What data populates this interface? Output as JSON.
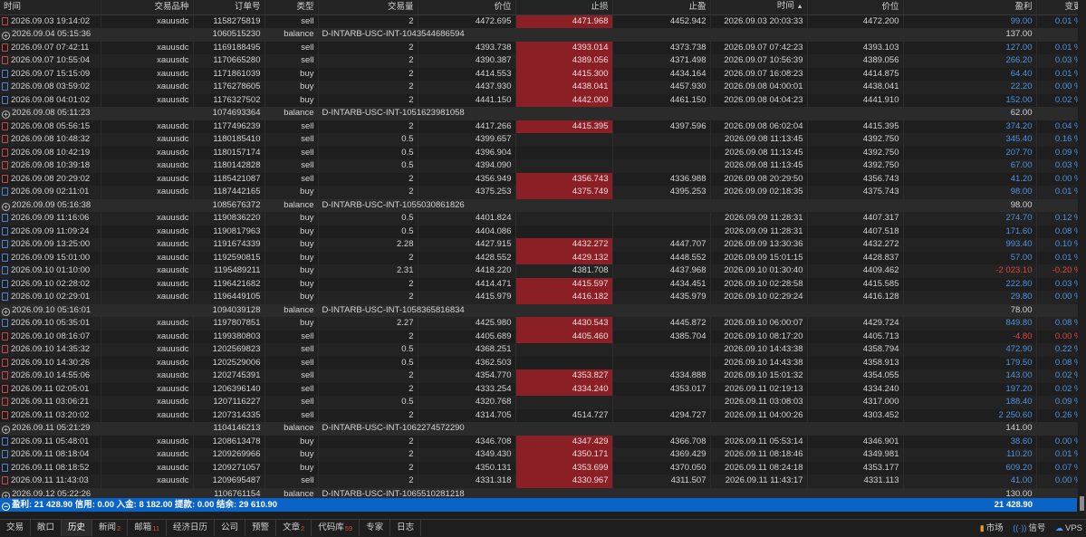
{
  "headers": [
    "时间",
    "交易品种",
    "订单号",
    "类型",
    "交易量",
    "价位",
    "止损",
    "止盈",
    "时间",
    "价位",
    "盈利",
    "变更"
  ],
  "sort_indicator": "▲",
  "rows": [
    {
      "kind": "trade",
      "t1": "2026.09.03 19:14:02",
      "sym": "xauusdc",
      "order": "1158275819",
      "type": "sell",
      "vol": "2",
      "p1": "4472.695",
      "sl": "4471.968",
      "sl_hit": true,
      "tp": "4452.942",
      "t2": "2026.09.03 20:03:33",
      "p2": "4472.200",
      "profit": "99.00",
      "chg": "0.01 %",
      "neg": false
    },
    {
      "kind": "balance",
      "t1": "2026.09.04 05:15:36",
      "order": "1060515230",
      "type": "balance",
      "comment": "D-INTARB-USC-INT-1043544686594",
      "profit": "137.00"
    },
    {
      "kind": "trade",
      "t1": "2026.09.07 07:42:11",
      "sym": "xauusdc",
      "order": "1169188495",
      "type": "sell",
      "vol": "2",
      "p1": "4393.738",
      "sl": "4393.014",
      "sl_hit": true,
      "tp": "4373.738",
      "t2": "2026.09.07 07:42:23",
      "p2": "4393.103",
      "profit": "127.00",
      "chg": "0.01 %",
      "neg": false
    },
    {
      "kind": "trade",
      "t1": "2026.09.07 10:55:04",
      "sym": "xauusdc",
      "order": "1170665280",
      "type": "sell",
      "vol": "2",
      "p1": "4390.387",
      "sl": "4389.056",
      "sl_hit": true,
      "tp": "4371.498",
      "t2": "2026.09.07 10:56:39",
      "p2": "4389.056",
      "profit": "266.20",
      "chg": "0.03 %",
      "neg": false
    },
    {
      "kind": "trade",
      "t1": "2026.09.07 15:15:09",
      "sym": "xauusdc",
      "order": "1171861039",
      "type": "buy",
      "vol": "2",
      "p1": "4414.553",
      "sl": "4415.300",
      "sl_hit": true,
      "tp": "4434.164",
      "t2": "2026.09.07 16:08:23",
      "p2": "4414.875",
      "profit": "64.40",
      "chg": "0.01 %",
      "neg": false
    },
    {
      "kind": "trade",
      "t1": "2026.09.08 03:59:02",
      "sym": "xauusdc",
      "order": "1176278605",
      "type": "buy",
      "vol": "2",
      "p1": "4437.930",
      "sl": "4438.041",
      "sl_hit": true,
      "tp": "4457.930",
      "t2": "2026.09.08 04:00:01",
      "p2": "4438.041",
      "profit": "22.20",
      "chg": "0.00 %",
      "neg": false
    },
    {
      "kind": "trade",
      "t1": "2026.09.08 04:01:02",
      "sym": "xauusdc",
      "order": "1176327502",
      "type": "buy",
      "vol": "2",
      "p1": "4441.150",
      "sl": "4442.000",
      "sl_hit": true,
      "tp": "4461.150",
      "t2": "2026.09.08 04:04:23",
      "p2": "4441.910",
      "profit": "152.00",
      "chg": "0.02 %",
      "neg": false
    },
    {
      "kind": "balance",
      "t1": "2026.09.08 05:11:23",
      "order": "1074693364",
      "type": "balance",
      "comment": "D-INTARB-USC-INT-1051623981058",
      "profit": "62.00"
    },
    {
      "kind": "trade",
      "t1": "2026.09.08 05:56:15",
      "sym": "xauusdc",
      "order": "1177496239",
      "type": "sell",
      "vol": "2",
      "p1": "4417.266",
      "sl": "4415.395",
      "sl_hit": true,
      "tp": "4397.596",
      "t2": "2026.09.08 06:02:04",
      "p2": "4415.395",
      "profit": "374.20",
      "chg": "0.04 %",
      "neg": false
    },
    {
      "kind": "trade",
      "t1": "2026.09.08 10:48:32",
      "sym": "xauusdc",
      "order": "1180185410",
      "type": "sell",
      "vol": "0.5",
      "p1": "4399.657",
      "sl": "",
      "sl_hit": false,
      "tp": "",
      "t2": "2026.09.08 11:13:45",
      "p2": "4392.750",
      "profit": "345.40",
      "chg": "0.16 %",
      "neg": false
    },
    {
      "kind": "trade",
      "t1": "2026.09.08 10:42:19",
      "sym": "xauusdc",
      "order": "1180157174",
      "type": "sell",
      "vol": "0.5",
      "p1": "4396.904",
      "sl": "",
      "sl_hit": false,
      "tp": "",
      "t2": "2026.09.08 11:13:45",
      "p2": "4392.750",
      "profit": "207.70",
      "chg": "0.09 %",
      "neg": false
    },
    {
      "kind": "trade",
      "t1": "2026.09.08 10:39:18",
      "sym": "xauusdc",
      "order": "1180142828",
      "type": "sell",
      "vol": "0.5",
      "p1": "4394.090",
      "sl": "",
      "sl_hit": false,
      "tp": "",
      "t2": "2026.09.08 11:13:45",
      "p2": "4392.750",
      "profit": "67.00",
      "chg": "0.03 %",
      "neg": false
    },
    {
      "kind": "trade",
      "t1": "2026.09.08 20:29:02",
      "sym": "xauusdc",
      "order": "1185421087",
      "type": "sell",
      "vol": "2",
      "p1": "4356.949",
      "sl": "4356.743",
      "sl_hit": true,
      "tp": "4336.988",
      "t2": "2026.09.08 20:29:50",
      "p2": "4356.743",
      "profit": "41.20",
      "chg": "0.00 %",
      "neg": false
    },
    {
      "kind": "trade",
      "t1": "2026.09.09 02:11:01",
      "sym": "xauusdc",
      "order": "1187442165",
      "type": "buy",
      "vol": "2",
      "p1": "4375.253",
      "sl": "4375.749",
      "sl_hit": true,
      "tp": "4395.253",
      "t2": "2026.09.09 02:18:35",
      "p2": "4375.743",
      "profit": "98.00",
      "chg": "0.01 %",
      "neg": false
    },
    {
      "kind": "balance",
      "t1": "2026.09.09 05:16:38",
      "order": "1085676372",
      "type": "balance",
      "comment": "D-INTARB-USC-INT-1055030861826",
      "profit": "98.00"
    },
    {
      "kind": "trade",
      "t1": "2026.09.09 11:16:06",
      "sym": "xauusdc",
      "order": "1190836220",
      "type": "buy",
      "vol": "0.5",
      "p1": "4401.824",
      "sl": "",
      "sl_hit": false,
      "tp": "",
      "t2": "2026.09.09 11:28:31",
      "p2": "4407.317",
      "profit": "274.70",
      "chg": "0.12 %",
      "neg": false
    },
    {
      "kind": "trade",
      "t1": "2026.09.09 11:09:24",
      "sym": "xauusdc",
      "order": "1190817963",
      "type": "buy",
      "vol": "0.5",
      "p1": "4404.086",
      "sl": "",
      "sl_hit": false,
      "tp": "",
      "t2": "2026.09.09 11:28:31",
      "p2": "4407.518",
      "profit": "171.60",
      "chg": "0.08 %",
      "neg": false
    },
    {
      "kind": "trade",
      "t1": "2026.09.09 13:25:00",
      "sym": "xauusdc",
      "order": "1191674339",
      "type": "buy",
      "vol": "2.28",
      "p1": "4427.915",
      "sl": "4432.272",
      "sl_hit": true,
      "tp": "4447.707",
      "t2": "2026.09.09 13:30:36",
      "p2": "4432.272",
      "profit": "993.40",
      "chg": "0.10 %",
      "neg": false
    },
    {
      "kind": "trade",
      "t1": "2026.09.09 15:01:00",
      "sym": "xauusdc",
      "order": "1192590815",
      "type": "buy",
      "vol": "2",
      "p1": "4428.552",
      "sl": "4429.132",
      "sl_hit": true,
      "tp": "4448.552",
      "t2": "2026.09.09 15:01:15",
      "p2": "4428.837",
      "profit": "57.00",
      "chg": "0.01 %",
      "neg": false
    },
    {
      "kind": "trade",
      "t1": "2026.09.10 01:10:00",
      "sym": "xauusdc",
      "order": "1195489211",
      "type": "buy",
      "vol": "2.31",
      "p1": "4418.220",
      "sl": "4381.708",
      "sl_hit": false,
      "tp": "4437.968",
      "t2": "2026.09.10 01:30:40",
      "p2": "4409.462",
      "profit": "-2 023.10",
      "chg": "-0.20 %",
      "neg": true
    },
    {
      "kind": "trade",
      "t1": "2026.09.10 02:28:02",
      "sym": "xauusdc",
      "order": "1196421682",
      "type": "buy",
      "vol": "2",
      "p1": "4414.471",
      "sl": "4415.597",
      "sl_hit": true,
      "tp": "4434.451",
      "t2": "2026.09.10 02:28:58",
      "p2": "4415.585",
      "profit": "222.80",
      "chg": "0.03 %",
      "neg": false
    },
    {
      "kind": "trade",
      "t1": "2026.09.10 02:29:01",
      "sym": "xauusdc",
      "order": "1196449105",
      "type": "buy",
      "vol": "2",
      "p1": "4415.979",
      "sl": "4416.182",
      "sl_hit": true,
      "tp": "4435.979",
      "t2": "2026.09.10 02:29:24",
      "p2": "4416.128",
      "profit": "29.80",
      "chg": "0.00 %",
      "neg": false
    },
    {
      "kind": "balance",
      "t1": "2026.09.10 05:16:01",
      "order": "1094039128",
      "type": "balance",
      "comment": "D-INTARB-USC-INT-1058365816834",
      "profit": "78.00"
    },
    {
      "kind": "trade",
      "t1": "2026.09.10 05:35:01",
      "sym": "xauusdc",
      "order": "1197807851",
      "type": "buy",
      "vol": "2.27",
      "p1": "4425.980",
      "sl": "4430.543",
      "sl_hit": true,
      "tp": "4445.872",
      "t2": "2026.09.10 06:00:07",
      "p2": "4429.724",
      "profit": "849.80",
      "chg": "0.08 %",
      "neg": false
    },
    {
      "kind": "trade",
      "t1": "2026.09.10 08:16:07",
      "sym": "xauusdc",
      "order": "1199380803",
      "type": "sell",
      "vol": "2",
      "p1": "4405.689",
      "sl": "4405.460",
      "sl_hit": true,
      "tp": "4385.704",
      "t2": "2026.09.10 08:17:20",
      "p2": "4405.713",
      "profit": "-4.80",
      "chg": "0.00 %",
      "neg": true
    },
    {
      "kind": "trade",
      "t1": "2026.09.10 14:35:32",
      "sym": "xauusdc",
      "order": "1202569823",
      "type": "sell",
      "vol": "0.5",
      "p1": "4368.251",
      "sl": "",
      "sl_hit": false,
      "tp": "",
      "t2": "2026.09.10 14:43:38",
      "p2": "4358.794",
      "profit": "472.90",
      "chg": "0.22 %",
      "neg": false
    },
    {
      "kind": "trade",
      "t1": "2026.09.10 14:30:26",
      "sym": "xauusdc",
      "order": "1202529006",
      "type": "sell",
      "vol": "0.5",
      "p1": "4362.503",
      "sl": "",
      "sl_hit": false,
      "tp": "",
      "t2": "2026.09.10 14:43:38",
      "p2": "4358.913",
      "profit": "179.50",
      "chg": "0.08 %",
      "neg": false
    },
    {
      "kind": "trade",
      "t1": "2026.09.10 14:55:06",
      "sym": "xauusdc",
      "order": "1202745391",
      "type": "sell",
      "vol": "2",
      "p1": "4354.770",
      "sl": "4353.827",
      "sl_hit": true,
      "tp": "4334.888",
      "t2": "2026.09.10 15:01:32",
      "p2": "4354.055",
      "profit": "143.00",
      "chg": "0.02 %",
      "neg": false
    },
    {
      "kind": "trade",
      "t1": "2026.09.11 02:05:01",
      "sym": "xauusdc",
      "order": "1206396140",
      "type": "sell",
      "vol": "2",
      "p1": "4333.254",
      "sl": "4334.240",
      "sl_hit": true,
      "tp": "4353.017",
      "t2": "2026.09.11 02:19:13",
      "p2": "4334.240",
      "profit": "197.20",
      "chg": "0.02 %",
      "neg": false
    },
    {
      "kind": "trade",
      "t1": "2026.09.11 03:06:21",
      "sym": "xauusdc",
      "order": "1207116227",
      "type": "sell",
      "vol": "0.5",
      "p1": "4320.768",
      "sl": "",
      "sl_hit": false,
      "tp": "",
      "t2": "2026.09.11 03:08:03",
      "p2": "4317.000",
      "profit": "188.40",
      "chg": "0.09 %",
      "neg": false
    },
    {
      "kind": "trade",
      "t1": "2026.09.11 03:20:02",
      "sym": "xauusdc",
      "order": "1207314335",
      "type": "sell",
      "vol": "2",
      "p1": "4314.705",
      "sl": "4514.727",
      "sl_hit": false,
      "tp": "4294.727",
      "t2": "2026.09.11 04:00:26",
      "p2": "4303.452",
      "profit": "2 250.60",
      "chg": "0.26 %",
      "neg": false
    },
    {
      "kind": "balance",
      "t1": "2026.09.11 05:21:29",
      "order": "1104146213",
      "type": "balance",
      "comment": "D-INTARB-USC-INT-1062274572290",
      "profit": "141.00"
    },
    {
      "kind": "trade",
      "t1": "2026.09.11 05:48:01",
      "sym": "xauusdc",
      "order": "1208613478",
      "type": "buy",
      "vol": "2",
      "p1": "4346.708",
      "sl": "4347.429",
      "sl_hit": true,
      "tp": "4366.708",
      "t2": "2026.09.11 05:53:14",
      "p2": "4346.901",
      "profit": "38.60",
      "chg": "0.00 %",
      "neg": false
    },
    {
      "kind": "trade",
      "t1": "2026.09.11 08:18:04",
      "sym": "xauusdc",
      "order": "1209269966",
      "type": "buy",
      "vol": "2",
      "p1": "4349.430",
      "sl": "4350.171",
      "sl_hit": true,
      "tp": "4369.429",
      "t2": "2026.09.11 08:18:46",
      "p2": "4349.981",
      "profit": "110.20",
      "chg": "0.01 %",
      "neg": false
    },
    {
      "kind": "trade",
      "t1": "2026.09.11 08:18:52",
      "sym": "xauusdc",
      "order": "1209271057",
      "type": "buy",
      "vol": "2",
      "p1": "4350.131",
      "sl": "4353.699",
      "sl_hit": true,
      "tp": "4370.050",
      "t2": "2026.09.11 08:24:18",
      "p2": "4353.177",
      "profit": "609.20",
      "chg": "0.07 %",
      "neg": false
    },
    {
      "kind": "trade",
      "t1": "2026.09.11 11:43:03",
      "sym": "xauusdc",
      "order": "1209695487",
      "type": "sell",
      "vol": "2",
      "p1": "4331.318",
      "sl": "4330.967",
      "sl_hit": true,
      "tp": "4311.507",
      "t2": "2026.09.11 11:43:17",
      "p2": "4331.113",
      "profit": "41.00",
      "chg": "0.00 %",
      "neg": false
    },
    {
      "kind": "balance",
      "t1": "2026.09.12 05:22:26",
      "order": "1106761154",
      "type": "balance",
      "comment": "D-INTARB-USC-INT-1065510281218",
      "profit": "130.00"
    }
  ],
  "summary": {
    "text": "盈利: 21 428.90  信用: 0.00  入金: 8 182.00  提款: 0.00  结余: 29 610.90",
    "balance": "21 428.90"
  },
  "tabs": [
    {
      "label": "交易",
      "badge": ""
    },
    {
      "label": "敞口",
      "badge": ""
    },
    {
      "label": "历史",
      "badge": "",
      "active": true
    },
    {
      "label": "新闻",
      "badge": "2"
    },
    {
      "label": "邮箱",
      "badge": "11"
    },
    {
      "label": "经济日历",
      "badge": ""
    },
    {
      "label": "公司",
      "badge": ""
    },
    {
      "label": "预警",
      "badge": ""
    },
    {
      "label": "文章",
      "badge": "2"
    },
    {
      "label": "代码库",
      "badge": "59"
    },
    {
      "label": "专家",
      "badge": ""
    },
    {
      "label": "日志",
      "badge": ""
    }
  ],
  "status": {
    "market": "市场",
    "signals": "信号",
    "vps": "VPS"
  },
  "colors": {
    "accent": "#0a63c7",
    "loss_cell": "#8b1f26",
    "profit_text": "#4d93e0",
    "loss_text": "#e04545"
  }
}
